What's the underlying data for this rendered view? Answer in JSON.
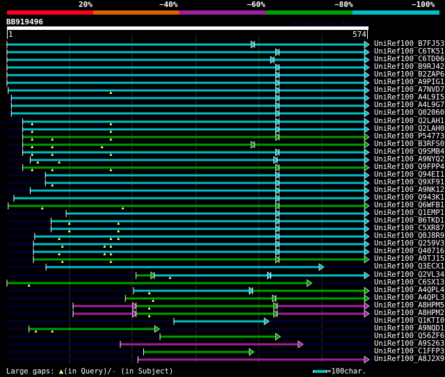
{
  "legend": {
    "labels": [
      "20%",
      "~40%",
      "~60%",
      "~80%",
      "~100%"
    ],
    "colors": [
      "#ff0020",
      "#e06000",
      "#a020a0",
      "#00a000",
      "#00c0c8"
    ]
  },
  "query": {
    "name": "BB919496",
    "start": "1",
    "end": "574",
    "length": 574
  },
  "credit": "AlignView.pm Beta v1.7",
  "colors": {
    "cyan": "#00c0c8",
    "green": "#00a000",
    "magenta": "#a020a0",
    "gap": "#ffff80",
    "subject_bg": "#000033",
    "grid": "#333300"
  },
  "hits": [
    {
      "label": "UniRef100_B7FJ53",
      "segs": [
        [
          1,
          394,
          "cyan"
        ],
        [
          394,
          574,
          "cyan"
        ]
      ],
      "qgaps": []
    },
    {
      "label": "UniRef100_C6TK51",
      "segs": [
        [
          1,
          433,
          "cyan"
        ],
        [
          433,
          574,
          "cyan"
        ]
      ],
      "qgaps": []
    },
    {
      "label": "UniRef100_C6TD06",
      "segs": [
        [
          1,
          425,
          "cyan"
        ],
        [
          425,
          574,
          "cyan"
        ]
      ],
      "qgaps": []
    },
    {
      "label": "UniRef100_B9RJ42",
      "segs": [
        [
          1,
          433,
          "cyan"
        ],
        [
          433,
          574,
          "cyan"
        ]
      ],
      "qgaps": []
    },
    {
      "label": "UniRef100_B2ZAP6",
      "segs": [
        [
          1,
          433,
          "cyan"
        ],
        [
          433,
          574,
          "cyan"
        ]
      ],
      "qgaps": []
    },
    {
      "label": "UniRef100_A9PIG1",
      "segs": [
        [
          1,
          433,
          "cyan"
        ],
        [
          433,
          574,
          "cyan"
        ]
      ],
      "qgaps": []
    },
    {
      "label": "UniRef100_A7NVD7",
      "segs": [
        [
          3,
          433,
          "cyan"
        ],
        [
          433,
          574,
          "cyan"
        ]
      ],
      "qgaps": [
        166
      ]
    },
    {
      "label": "UniRef100_A4L9I5",
      "segs": [
        [
          8,
          433,
          "cyan"
        ],
        [
          433,
          574,
          "cyan"
        ]
      ],
      "qgaps": []
    },
    {
      "label": "UniRef100_A4L9G7",
      "segs": [
        [
          8,
          433,
          "cyan"
        ],
        [
          433,
          574,
          "cyan"
        ]
      ],
      "qgaps": []
    },
    {
      "label": "UniRef100_Q02060",
      "segs": [
        [
          8,
          433,
          "cyan"
        ],
        [
          433,
          574,
          "cyan"
        ]
      ],
      "qgaps": []
    },
    {
      "label": "UniRef100_Q2LAH1",
      "segs": [
        [
          26,
          433,
          "cyan"
        ],
        [
          433,
          574,
          "cyan"
        ]
      ],
      "qgaps": [
        41,
        166
      ]
    },
    {
      "label": "UniRef100_Q2LAH0",
      "segs": [
        [
          26,
          433,
          "cyan"
        ],
        [
          433,
          574,
          "cyan"
        ]
      ],
      "qgaps": [
        41,
        166
      ]
    },
    {
      "label": "UniRef100_P54773",
      "segs": [
        [
          26,
          433,
          "green"
        ],
        [
          433,
          574,
          "green"
        ]
      ],
      "qgaps": [
        41,
        73,
        166
      ]
    },
    {
      "label": "UniRef100_B3RFS0",
      "segs": [
        [
          26,
          394,
          "green"
        ],
        [
          394,
          574,
          "green"
        ]
      ],
      "qgaps": [
        41,
        73,
        152
      ]
    },
    {
      "label": "UniRef100_Q9SMB4",
      "segs": [
        [
          26,
          433,
          "cyan"
        ],
        [
          433,
          574,
          "cyan"
        ]
      ],
      "qgaps": [
        41,
        73,
        166
      ]
    },
    {
      "label": "UniRef100_A9NYQ2",
      "segs": [
        [
          38,
          430,
          "cyan"
        ],
        [
          430,
          574,
          "cyan"
        ]
      ],
      "qgaps": [
        50,
        84
      ]
    },
    {
      "label": "UniRef100_Q9FPP4",
      "segs": [
        [
          26,
          433,
          "green"
        ],
        [
          433,
          574,
          "green"
        ]
      ],
      "qgaps": [
        41,
        73,
        166
      ]
    },
    {
      "label": "UniRef100_Q94EI1",
      "segs": [
        [
          62,
          433,
          "cyan"
        ],
        [
          433,
          574,
          "cyan"
        ]
      ],
      "qgaps": []
    },
    {
      "label": "UniRef100_Q9XF91",
      "segs": [
        [
          62,
          433,
          "cyan"
        ],
        [
          433,
          574,
          "cyan"
        ]
      ],
      "qgaps": [
        73
      ]
    },
    {
      "label": "UniRef100_A9NK12",
      "segs": [
        [
          38,
          433,
          "cyan"
        ],
        [
          433,
          574,
          "cyan"
        ]
      ],
      "qgaps": []
    },
    {
      "label": "UniRef100_Q943K1",
      "segs": [
        [
          12,
          433,
          "cyan"
        ],
        [
          433,
          574,
          "cyan"
        ]
      ],
      "qgaps": []
    },
    {
      "label": "UniRef100_Q6WFB1",
      "segs": [
        [
          3,
          433,
          "green"
        ],
        [
          433,
          574,
          "green"
        ]
      ],
      "qgaps": [
        57,
        185
      ]
    },
    {
      "label": "UniRef100_Q1EMP1",
      "segs": [
        [
          95,
          433,
          "cyan"
        ],
        [
          433,
          574,
          "cyan"
        ]
      ],
      "qgaps": []
    },
    {
      "label": "UniRef100_B6TKD1",
      "segs": [
        [
          71,
          433,
          "cyan"
        ],
        [
          433,
          574,
          "cyan"
        ]
      ],
      "qgaps": [
        100,
        178
      ]
    },
    {
      "label": "UniRef100_C5XR87",
      "segs": [
        [
          71,
          433,
          "cyan"
        ],
        [
          433,
          574,
          "cyan"
        ]
      ],
      "qgaps": [
        100,
        178
      ]
    },
    {
      "label": "UniRef100_Q0J8R9",
      "segs": [
        [
          45,
          433,
          "cyan"
        ],
        [
          433,
          574,
          "cyan"
        ]
      ],
      "qgaps": [
        84,
        166,
        178
      ]
    },
    {
      "label": "UniRef100_Q259V3",
      "segs": [
        [
          43,
          433,
          "cyan"
        ],
        [
          433,
          574,
          "cyan"
        ]
      ],
      "qgaps": [
        89,
        156,
        166
      ]
    },
    {
      "label": "UniRef100_Q40716",
      "segs": [
        [
          43,
          433,
          "cyan"
        ],
        [
          433,
          574,
          "cyan"
        ]
      ],
      "qgaps": [
        84,
        156,
        166
      ]
    },
    {
      "label": "UniRef100_A9TJ15",
      "segs": [
        [
          43,
          433,
          "green"
        ],
        [
          433,
          574,
          "green"
        ]
      ],
      "qgaps": [
        89,
        166
      ]
    },
    {
      "label": "UniRef100_Q3ECX1",
      "segs": [
        [
          63,
          502,
          "cyan"
        ]
      ],
      "qgaps": []
    },
    {
      "label": "UniRef100_Q2VL34",
      "segs": [
        [
          206,
          235,
          "green"
        ],
        [
          235,
          420,
          "cyan"
        ],
        [
          420,
          574,
          "cyan"
        ]
      ],
      "qgaps": [
        260
      ]
    },
    {
      "label": "UniRef100_C6SX13",
      "segs": [
        [
          1,
          483,
          "green"
        ]
      ],
      "qgaps": [
        36
      ]
    },
    {
      "label": "UniRef100_A4QPL4",
      "segs": [
        [
          202,
          391,
          "cyan"
        ],
        [
          391,
          574,
          "green"
        ]
      ],
      "qgaps": [
        227
      ]
    },
    {
      "label": "UniRef100_A4QPL3",
      "segs": [
        [
          189,
          428,
          "green"
        ],
        [
          428,
          574,
          "green"
        ]
      ],
      "qgaps": [
        233
      ]
    },
    {
      "label": "UniRef100_A8HPM5",
      "segs": [
        [
          106,
          206,
          "magenta"
        ],
        [
          206,
          430,
          "green"
        ],
        [
          430,
          574,
          "magenta"
        ]
      ],
      "qgaps": [
        227
      ]
    },
    {
      "label": "UniRef100_A8HPM2",
      "segs": [
        [
          106,
          206,
          "magenta"
        ],
        [
          206,
          430,
          "green"
        ],
        [
          430,
          574,
          "magenta"
        ]
      ],
      "qgaps": [
        227
      ]
    },
    {
      "label": "UniRef100_Q1KTI0",
      "segs": [
        [
          266,
          415,
          "cyan"
        ]
      ],
      "qgaps": []
    },
    {
      "label": "UniRef100_A9NQD1",
      "segs": [
        [
          36,
          241,
          "green"
        ]
      ],
      "qgaps": [
        47,
        73
      ]
    },
    {
      "label": "UniRef100_Q56ZF6",
      "segs": [
        [
          244,
          433,
          "green"
        ]
      ],
      "qgaps": []
    },
    {
      "label": "UniRef100_A9S263",
      "segs": [
        [
          181,
          469,
          "magenta"
        ]
      ],
      "qgaps": []
    },
    {
      "label": "UniRef100_C1FFP3",
      "segs": [
        [
          218,
          391,
          "green"
        ]
      ],
      "qgaps": []
    },
    {
      "label": "UniRef100_A8J2X9",
      "segs": [
        [
          209,
          574,
          "magenta"
        ]
      ],
      "qgaps": []
    }
  ],
  "footer": {
    "gaps_label": "Large gaps:",
    "in_query": "(in Query)/",
    "in_subject": "(in Subject)",
    "scale_label": "=100char."
  }
}
